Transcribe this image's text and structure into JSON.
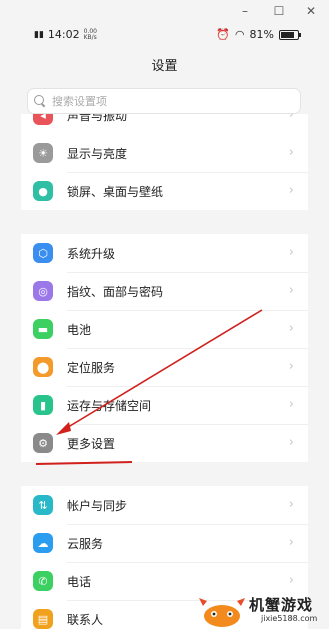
{
  "window": {
    "minimize": "–",
    "maximize": "☐",
    "close": "✕"
  },
  "status": {
    "time": "14:02",
    "speed": "0.00 KB/s",
    "battery": "81%",
    "battery_level": 0.81
  },
  "header": {
    "title": "设置"
  },
  "search": {
    "placeholder": "搜索设置项"
  },
  "groups": [
    {
      "items": [
        {
          "label": "声音与振动",
          "icon": "speaker-icon",
          "color": "#e8545a",
          "glyph": "◂"
        },
        {
          "label": "显示与亮度",
          "icon": "brightness-icon",
          "color": "#9a9a9a",
          "glyph": "☀"
        },
        {
          "label": "锁屏、桌面与壁纸",
          "icon": "palette-icon",
          "color": "#2fbfa5",
          "glyph": "●"
        }
      ]
    },
    {
      "items": [
        {
          "label": "系统升级",
          "icon": "system-update-icon",
          "color": "#3a8ef0",
          "glyph": "⬡"
        },
        {
          "label": "指纹、面部与密码",
          "icon": "fingerprint-icon",
          "color": "#9a78e8",
          "glyph": "◎"
        },
        {
          "label": "电池",
          "icon": "battery-icon",
          "color": "#3ccf62",
          "glyph": "▬"
        },
        {
          "label": "定位服务",
          "icon": "location-icon",
          "color": "#f39a2b",
          "glyph": "⬤"
        },
        {
          "label": "运存与存储空间",
          "icon": "storage-icon",
          "color": "#29c48c",
          "glyph": "▮"
        },
        {
          "label": "更多设置",
          "icon": "more-settings-icon",
          "color": "#8a8a8a",
          "glyph": "⚙"
        }
      ]
    },
    {
      "items": [
        {
          "label": "帐户与同步",
          "icon": "account-sync-icon",
          "color": "#28b8c8",
          "glyph": "⇅"
        },
        {
          "label": "云服务",
          "icon": "cloud-icon",
          "color": "#2a9df0",
          "glyph": "☁"
        },
        {
          "label": "电话",
          "icon": "phone-icon",
          "color": "#3ccf62",
          "glyph": "✆"
        },
        {
          "label": "联系人",
          "icon": "contacts-icon",
          "color": "#f0a21f",
          "glyph": "▤"
        }
      ]
    }
  ],
  "chevron": "›",
  "watermark": {
    "brand": "机蟹游戏",
    "site": "jixie5188.com"
  }
}
